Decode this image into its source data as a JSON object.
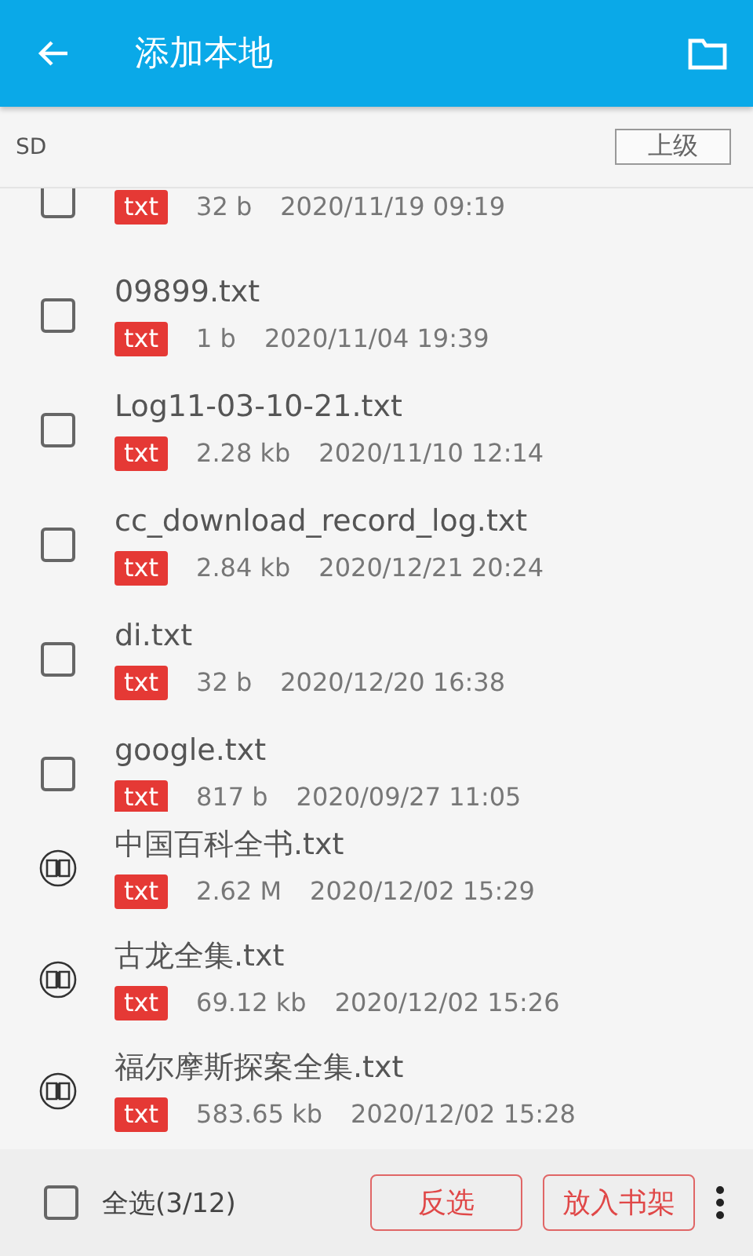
{
  "header": {
    "title": "添加本地"
  },
  "path_bar": {
    "path": "SD",
    "up_button": "上级"
  },
  "file_list": [
    {
      "kind": "file",
      "checked": false,
      "badge": "txt",
      "size": "32 b",
      "date": "2020/11/19 09:19"
    },
    {
      "kind": "file",
      "checked": false,
      "name": "09899.txt",
      "badge": "txt",
      "size": "1 b",
      "date": "2020/11/04 19:39"
    },
    {
      "kind": "file",
      "checked": false,
      "name": "Log11-03-10-21.txt",
      "badge": "txt",
      "size": "2.28 kb",
      "date": "2020/11/10 12:14"
    },
    {
      "kind": "file",
      "checked": false,
      "name": "cc_download_record_log.txt",
      "badge": "txt",
      "size": "2.84 kb",
      "date": "2020/12/21 20:24"
    },
    {
      "kind": "file",
      "checked": false,
      "name": "di.txt",
      "badge": "txt",
      "size": "32 b",
      "date": "2020/12/20 16:38"
    },
    {
      "kind": "file",
      "checked": false,
      "name": "google.txt",
      "badge": "txt",
      "size": "817 b",
      "date": "2020/09/27 11:05"
    }
  ],
  "book_list": [
    {
      "kind": "book",
      "name": "中国百科全书.txt",
      "badge": "txt",
      "size": "2.62 M",
      "date": "2020/12/02 15:29"
    },
    {
      "kind": "book",
      "name": "古龙全集.txt",
      "badge": "txt",
      "size": "69.12 kb",
      "date": "2020/12/02 15:26"
    },
    {
      "kind": "book",
      "name": "福尔摩斯探案全集.txt",
      "badge": "txt",
      "size": "583.65 kb",
      "date": "2020/12/02 15:28"
    }
  ],
  "bottom_bar": {
    "select_all": {
      "label": "全选(3/12)",
      "checked": false
    },
    "buttons": [
      "反选",
      "放入书架"
    ]
  }
}
